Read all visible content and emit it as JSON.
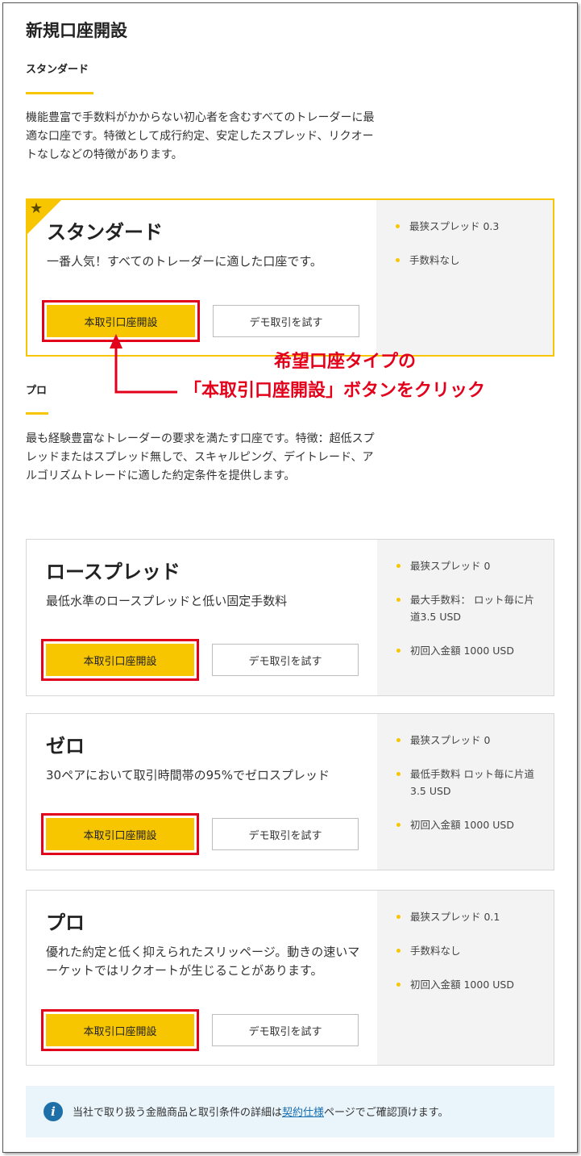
{
  "page": {
    "title": "新規口座開設"
  },
  "sections": {
    "standard": {
      "label": "スタンダード",
      "description": "機能豊富で手数料がかからない初心者を含むすべてのトレーダーに最適な口座です。特徴として成行約定、安定したスプレッド、リクオートなしなどの特徴があります。"
    },
    "pro": {
      "label": "プロ",
      "description": "最も経験豊富なトレーダーの要求を満たす口座です。特徴：超低スプレッドまたはスプレッド無しで、スキャルピング、デイトレード、アルゴリズムトレードに適した約定条件を提供します。"
    }
  },
  "cards": [
    {
      "title": "スタンダード",
      "description": "一番人気！すべてのトレーダーに適した口座です。",
      "primary_label": "本取引口座開設",
      "secondary_label": "デモ取引を試す",
      "features": [
        "最狭スプレッド 0.3",
        "手数料なし"
      ]
    },
    {
      "title": "ロースプレッド",
      "description": "最低水準のロースプレッドと低い固定手数料",
      "primary_label": "本取引口座開設",
      "secondary_label": "デモ取引を試す",
      "features": [
        "最狭スプレッド 0",
        "最大手数料： ロット毎に片道3.5 USD",
        "初回入金額 1000 USD"
      ]
    },
    {
      "title": "ゼロ",
      "description": "30ペアにおいて取引時間帯の95%でゼロスプレッド",
      "primary_label": "本取引口座開設",
      "secondary_label": "デモ取引を試す",
      "features": [
        "最狭スプレッド 0",
        "最低手数料 ロット毎に片道3.5 USD",
        "初回入金額 1000 USD"
      ]
    },
    {
      "title": "プロ",
      "description": "優れた約定と低く抑えられたスリッページ。動きの速いマーケットではリクオートが生じることがあります。",
      "primary_label": "本取引口座開設",
      "secondary_label": "デモ取引を試す",
      "features": [
        "最狭スプレッド 0.1",
        "手数料なし",
        "初回入金額 1000 USD"
      ]
    }
  ],
  "annotation": {
    "line1": "希望口座タイプの",
    "line2": "「本取引口座開設」ボタンをクリック"
  },
  "info": {
    "text_before": "当社で取り扱う金融商品と取引条件の詳細は",
    "link": "契約仕様",
    "text_after": "ページでご確認頂けます。"
  },
  "colors": {
    "accent": "#f7c600",
    "annotation_red": "#e3001b",
    "info_bg": "#e9f4fb",
    "link": "#1a6fb0"
  },
  "icons": {
    "featured": "star-icon",
    "info": "info-icon"
  }
}
